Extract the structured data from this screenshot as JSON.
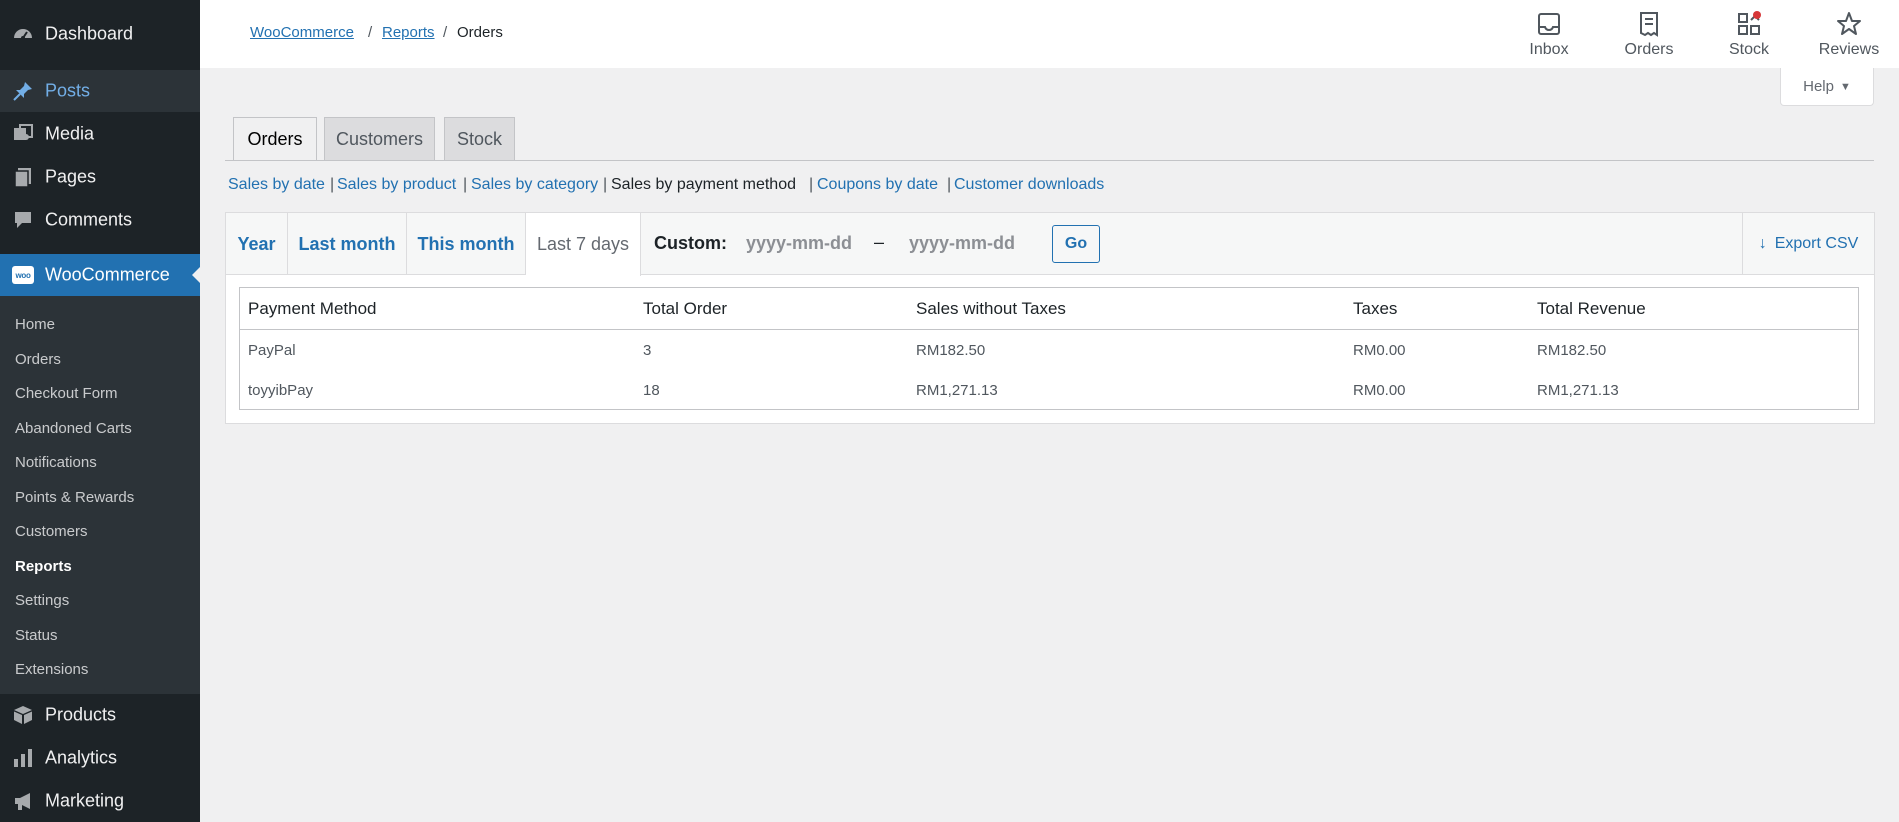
{
  "sidebar": {
    "top": [
      {
        "label": "Dashboard",
        "icon": "dashboard-icon"
      },
      {
        "label": "Posts",
        "icon": "pin-icon"
      },
      {
        "label": "Media",
        "icon": "media-icon"
      },
      {
        "label": "Pages",
        "icon": "pages-icon"
      },
      {
        "label": "Comments",
        "icon": "comment-icon"
      }
    ],
    "woocommerce": {
      "label": "WooCommerce",
      "logo_text": "woo"
    },
    "submenu": [
      "Home",
      "Orders",
      "Checkout Form",
      "Abandoned Carts",
      "Notifications",
      "Points & Rewards",
      "Customers",
      "Reports",
      "Settings",
      "Status",
      "Extensions"
    ],
    "bottom": [
      {
        "label": "Products",
        "icon": "box-icon"
      },
      {
        "label": "Analytics",
        "icon": "bar-chart-icon"
      },
      {
        "label": "Marketing",
        "icon": "megaphone-icon"
      }
    ]
  },
  "breadcrumb": {
    "items": [
      "WooCommerce",
      "Reports"
    ],
    "current": "Orders",
    "separator": "/"
  },
  "header_actions": [
    {
      "label": "Inbox",
      "icon": "inbox-icon"
    },
    {
      "label": "Orders",
      "icon": "orders-icon"
    },
    {
      "label": "Stock",
      "icon": "stock-icon",
      "badge": true
    },
    {
      "label": "Reviews",
      "icon": "star-icon"
    }
  ],
  "help": {
    "label": "Help",
    "arrow": "▼"
  },
  "tabs": [
    {
      "label": "Orders",
      "active": true
    },
    {
      "label": "Customers",
      "active": false
    },
    {
      "label": "Stock",
      "active": false
    }
  ],
  "subsub": [
    {
      "label": "Sales by date",
      "current": false
    },
    {
      "label": "Sales by product",
      "current": false
    },
    {
      "label": "Sales by category",
      "current": false
    },
    {
      "label": "Sales by payment method",
      "current": true
    },
    {
      "label": "Coupons by date",
      "current": false
    },
    {
      "label": "Customer downloads",
      "current": false
    }
  ],
  "ranges": [
    {
      "label": "Year",
      "active": false
    },
    {
      "label": "Last month",
      "active": false
    },
    {
      "label": "This month",
      "active": false
    },
    {
      "label": "Last 7 days",
      "active": true
    }
  ],
  "custom": {
    "label": "Custom:",
    "start_placeholder": "yyyy-mm-dd",
    "end_placeholder": "yyyy-mm-dd",
    "dash": "–",
    "go_label": "Go"
  },
  "export": {
    "label": "Export CSV",
    "icon": "↓"
  },
  "table": {
    "headers": [
      "Payment Method",
      "Total Order",
      "Sales without Taxes",
      "Taxes",
      "Total Revenue"
    ],
    "rows": [
      [
        "PayPal",
        "3",
        "RM182.50",
        "RM0.00",
        "RM182.50"
      ],
      [
        "toyyibPay",
        "18",
        "RM1,271.13",
        "RM0.00",
        "RM1,271.13"
      ]
    ]
  },
  "colors": {
    "sidebar_bg": "#1d2327",
    "accent": "#2271b1",
    "badge": "#d63638"
  }
}
